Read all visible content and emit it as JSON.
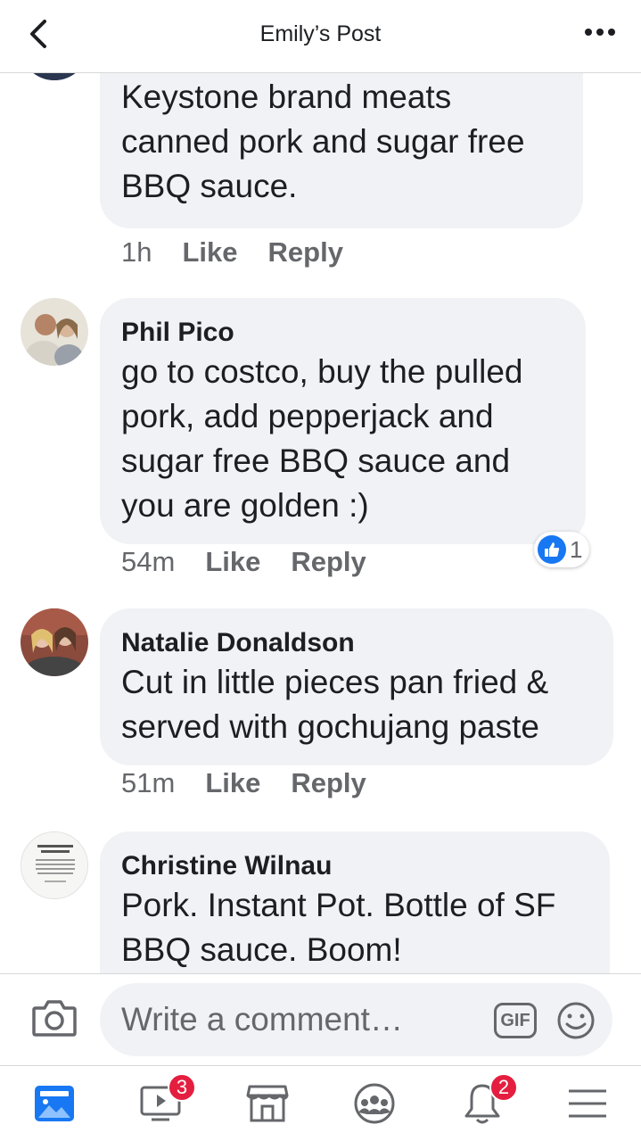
{
  "header": {
    "title": "Emily’s Post"
  },
  "comments": [
    {
      "author": "",
      "text": "Keystone brand meats canned pork and sugar free BBQ sauce.",
      "time": "1h",
      "like_label": "Like",
      "reply_label": "Reply"
    },
    {
      "author": "Phil Pico",
      "text": "go to costco, buy the pulled pork, add pepperjack and sugar free BBQ sauce and you are golden :)",
      "time": "54m",
      "like_label": "Like",
      "reply_label": "Reply",
      "reaction_count": "1"
    },
    {
      "author": "Natalie Donaldson",
      "text": "Cut in little pieces pan fried & served with gochujang paste",
      "time": "51m",
      "like_label": "Like",
      "reply_label": "Reply"
    },
    {
      "author": "Christine Wilnau",
      "text": "Pork. Instant Pot. Bottle of SF BBQ sauce. Boom!",
      "time": "",
      "like_label": "",
      "reply_label": ""
    }
  ],
  "composer": {
    "placeholder": "Write a comment…",
    "gif_label": "GIF"
  },
  "tabbar": {
    "watch_badge": "3",
    "notifications_badge": "2"
  },
  "icons": {
    "back": "chevron-left-icon",
    "more": "more-horizontal-icon",
    "camera": "camera-icon",
    "emoji": "emoji-icon",
    "reaction": "thumbs-up-icon",
    "news_feed": "news-feed-icon",
    "watch": "watch-icon",
    "marketplace": "marketplace-icon",
    "groups": "groups-icon",
    "notifications": "bell-icon",
    "menu": "menu-icon"
  },
  "colors": {
    "accent": "#1877f2",
    "badge": "#e41e3f",
    "bubble": "#f0f2f5",
    "secondary_text": "#65676b"
  }
}
